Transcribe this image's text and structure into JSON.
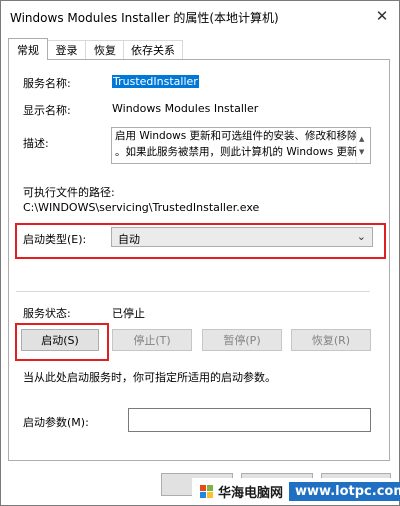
{
  "window": {
    "title": "Windows Modules Installer 的属性(本地计算机)",
    "close_glyph": "✕"
  },
  "tabs": [
    {
      "label": "常规",
      "active": true
    },
    {
      "label": "登录",
      "active": false
    },
    {
      "label": "恢复",
      "active": false
    },
    {
      "label": "依存关系",
      "active": false
    }
  ],
  "general": {
    "service_name_label": "服务名称:",
    "service_name_value": "TrustedInstaller",
    "display_name_label": "显示名称:",
    "display_name_value": "Windows Modules Installer",
    "description_label": "描述:",
    "description_line1": "启用 Windows 更新和可选组件的安装、修改和移除",
    "description_line2": "。如果此服务被禁用，则此计算机的 Windows 更新",
    "exec_path_label": "可执行文件的路径:",
    "exec_path_value": "C:\\WINDOWS\\servicing\\TrustedInstaller.exe",
    "startup_type_label": "启动类型(E):",
    "startup_type_value": "自动",
    "service_status_label": "服务状态:",
    "service_status_value": "已停止",
    "hint_text": "当从此处启动服务时，你可指定所适用的启动参数。",
    "start_params_label": "启动参数(M):",
    "start_params_value": ""
  },
  "buttons": {
    "start": "启动(S)",
    "stop": "停止(T)",
    "pause": "暂停(P)",
    "resume": "恢复(R)"
  },
  "watermark": {
    "text": "华海电脑网",
    "url": "www.lotpc.com"
  },
  "colors": {
    "highlight": "#0078d7",
    "annotation_red": "#e02020",
    "watermark_blue": "#1f6fc3"
  }
}
